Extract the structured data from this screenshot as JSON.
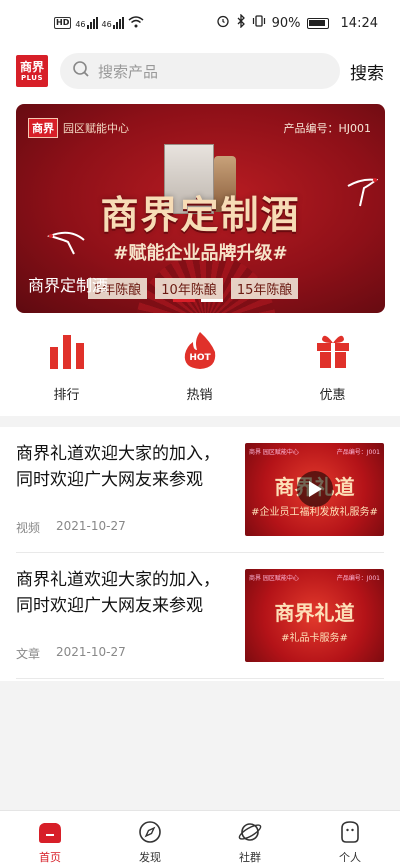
{
  "status_bar": {
    "badge": "HD",
    "network": "46",
    "battery": "90%",
    "time": "14:24"
  },
  "header": {
    "logo_line1": "商界",
    "logo_line2": "PLUS",
    "search_placeholder": "搜索产品",
    "search_label": "搜索"
  },
  "banner": {
    "brand_logo": "商界",
    "brand_text": "园区赋能中心",
    "product_code": "产品编号：HJ001",
    "title": "商界定制酒",
    "subtitle": "#赋能企业品牌升级#",
    "caption": "商界定制酒",
    "vintages": [
      "5年陈酿",
      "10年陈酿",
      "15年陈酿"
    ],
    "slides": 2,
    "active_slide": 1
  },
  "quick_nav": [
    {
      "label": "排行",
      "icon": "bar-chart-icon"
    },
    {
      "label": "热销",
      "icon": "hot-flame-icon"
    },
    {
      "label": "优惠",
      "icon": "gift-icon"
    }
  ],
  "feed": [
    {
      "title": "商界礼道欢迎大家的加入，同时欢迎广大网友来参观",
      "type": "视频",
      "date": "2021-10-27",
      "thumb_title": "商界礼道",
      "thumb_sub": "#企业员工福利发放礼服务#",
      "has_play": true
    },
    {
      "title": "商界礼道欢迎大家的加入，同时欢迎广大网友来参观",
      "type": "文章",
      "date": "2021-10-27",
      "thumb_title": "商界礼道",
      "thumb_sub": "#礼品卡服务#",
      "has_play": false
    }
  ],
  "tabbar": [
    {
      "label": "首页",
      "icon": "home-icon",
      "active": true
    },
    {
      "label": "发现",
      "icon": "compass-icon",
      "active": false
    },
    {
      "label": "社群",
      "icon": "planet-icon",
      "active": false
    },
    {
      "label": "个人",
      "icon": "profile-icon",
      "active": false
    }
  ],
  "colors": {
    "brand": "#d71f28",
    "background": "#f3f3f3"
  }
}
